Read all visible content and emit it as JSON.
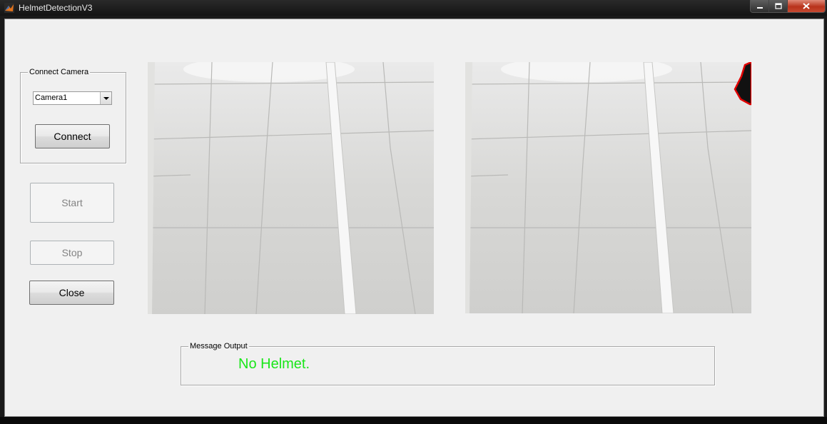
{
  "window": {
    "title": "HelmetDetectionV3"
  },
  "connect_panel": {
    "title": "Connect Camera",
    "camera_select": "Camera1",
    "connect_label": "Connect"
  },
  "controls": {
    "start_label": "Start",
    "stop_label": "Stop",
    "close_label": "Close"
  },
  "message_panel": {
    "title": "Message Output",
    "message": "No Helmet.",
    "message_color": "#19e619"
  },
  "colors": {
    "background": "#f0f0f0",
    "detection_box": "#e00000"
  }
}
